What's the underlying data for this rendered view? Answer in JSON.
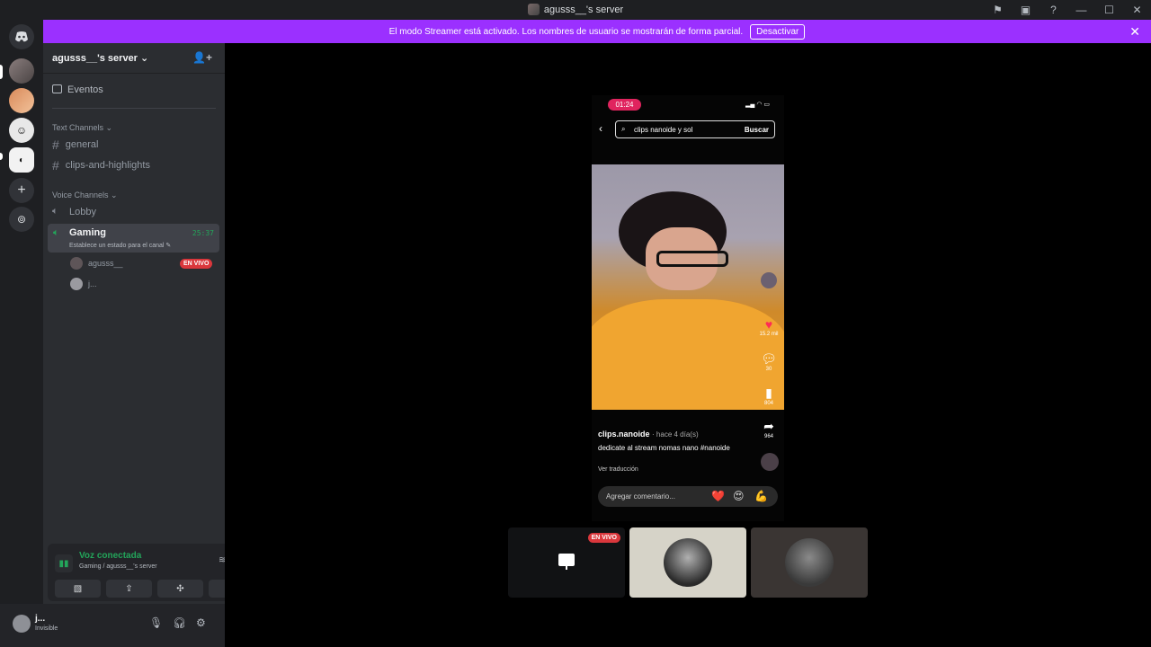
{
  "window": {
    "title": "agusss__'s server"
  },
  "titlebar_icons": [
    "inbox-flag-icon",
    "inbox-icon",
    "help-icon",
    "minimize-icon",
    "maximize-icon",
    "close-icon"
  ],
  "titlebar_glyphs": {
    "flag": "⚑",
    "inbox": "▣",
    "help": "?",
    "minimize": "—",
    "maximize": "☐",
    "close": "✕"
  },
  "banner": {
    "text": "El modo Streamer está activado. Los nombres de usuario se mostrarán de forma parcial.",
    "button": "Desactivar",
    "close": "✕",
    "color": "#9b30ff"
  },
  "server": {
    "name": "agusss__'s server ⌄",
    "add_user": "👤+"
  },
  "sidebar": {
    "events": "Eventos",
    "text_category": "Text Channels ⌄",
    "text_channels": [
      "general",
      "clips-and-highlights"
    ],
    "voice_category": "Voice Channels ⌄",
    "voice_channels": [
      "Lobby",
      "Gaming"
    ],
    "active_voice": {
      "name": "Gaming",
      "time": "25:37",
      "status": "Establece un estado para el canal ✎"
    },
    "voice_users": [
      {
        "name": "agusss__",
        "live": "EN VIVO"
      },
      {
        "name": "j..."
      }
    ]
  },
  "voice_panel": {
    "title": "Voz conectada",
    "subtitle": "Gaming / agusss__'s server",
    "buttons": [
      "camera-off-icon",
      "screen-share-icon",
      "activities-icon",
      "soundboard-icon"
    ]
  },
  "user": {
    "name": "j...",
    "status": "Invisible"
  },
  "stream": {
    "clock": "01:24",
    "search_query": "clips nanoide y sol",
    "search_button": "Buscar",
    "likes": "15.2 mil",
    "comments": "30",
    "saves": "804",
    "shares": "964",
    "author": "clips.nanoide",
    "posted": "· hace 4 día(s)",
    "caption": "dedicate al stream nomas nano #nanoide",
    "translate": "Ver traducción",
    "comment_placeholder": "Agregar comentario...",
    "emojis": [
      "❤️",
      "😍",
      "💪"
    ]
  },
  "tiles": [
    {
      "label": "EN VIVO",
      "kind": "screen"
    },
    {
      "kind": "avatar"
    },
    {
      "kind": "avatar"
    }
  ]
}
